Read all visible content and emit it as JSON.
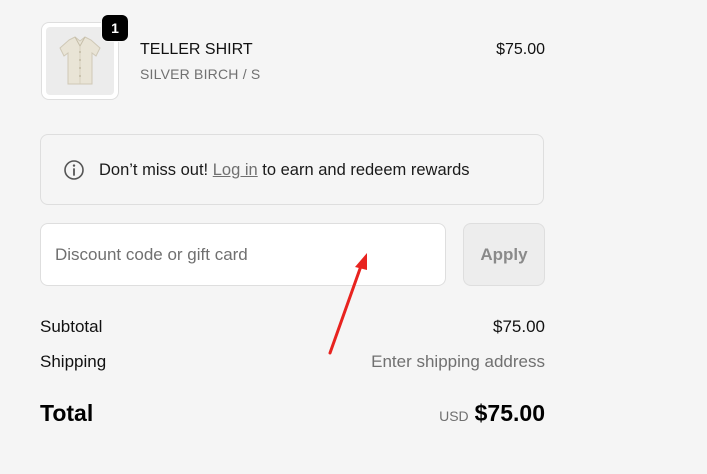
{
  "cart": {
    "item": {
      "name": "TELLER SHIRT",
      "variant": "SILVER BIRCH / S",
      "price": "$75.00",
      "quantity": "1",
      "image_icon": "shirt-thumbnail"
    }
  },
  "rewards": {
    "icon": "info-icon",
    "prefix": "Don’t miss out! ",
    "link_label": "Log in",
    "suffix": " to earn and redeem rewards"
  },
  "discount": {
    "placeholder": "Discount code or gift card",
    "value": "",
    "apply_label": "Apply"
  },
  "summary": {
    "subtotal_label": "Subtotal",
    "subtotal_value": "$75.00",
    "shipping_label": "Shipping",
    "shipping_value": "Enter shipping address",
    "total_label": "Total",
    "total_currency": "USD",
    "total_value": "$75.00"
  },
  "colors": {
    "background": "#f5f5f5",
    "annotation_arrow": "#e8231f",
    "link": "#707070"
  }
}
